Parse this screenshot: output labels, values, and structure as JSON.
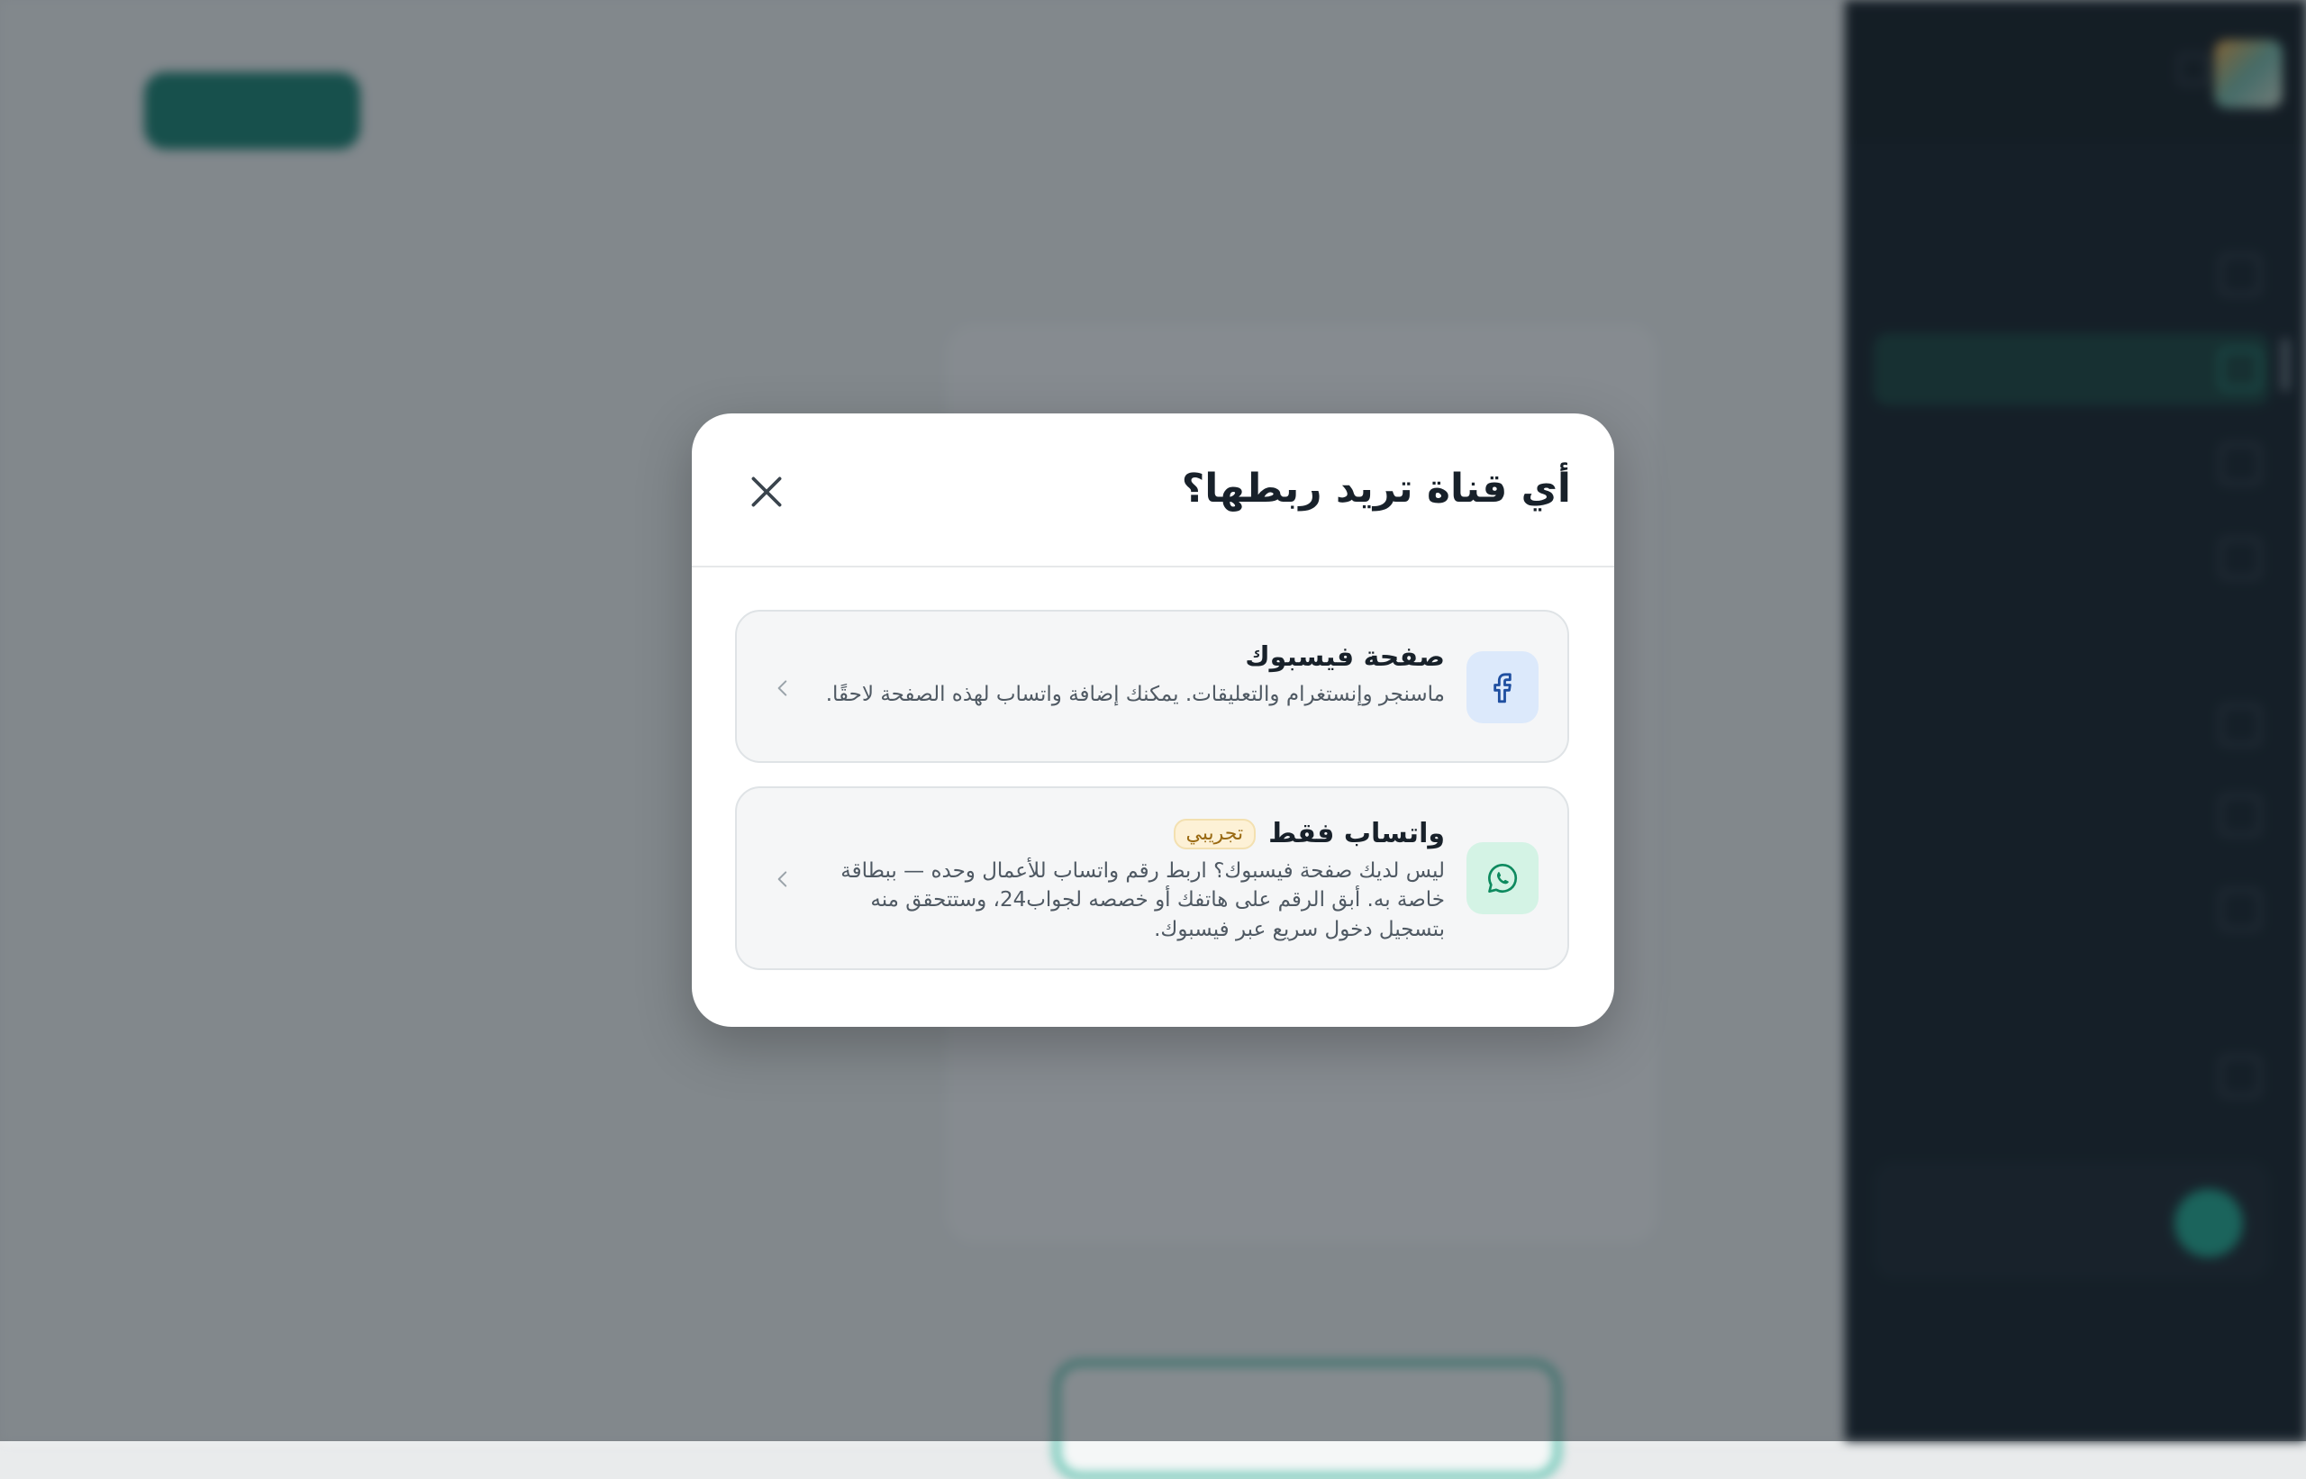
{
  "modal": {
    "title": "أي قناة تريد ربطها؟",
    "close_icon": "close-icon",
    "options": [
      {
        "id": "facebook",
        "title": "صفحة فيسبوك",
        "description": "ماسنجر وإنستغرام والتعليقات. يمكنك إضافة واتساب لهذه الصفحة لاحقًا.",
        "icon": "facebook-icon",
        "icon_color": "#1f4fa0",
        "icon_bg": "#dce9fb"
      },
      {
        "id": "whatsapp",
        "title": "واتساب فقط",
        "badge": "تجريبي",
        "description": "ليس لديك صفحة فيسبوك؟ اربط رقم واتساب للأعمال وحده — ببطاقة خاصة به. أبق الرقم على هاتفك أو خصصه لجواب24، وستتحقق منه بتسجيل دخول سريع عبر فيسبوك.",
        "icon": "whatsapp-icon",
        "icon_color": "#0e8a5f",
        "icon_bg": "#d4f3e5"
      }
    ]
  },
  "colors": {
    "accent": "#0f7b6b",
    "overlay": "rgba(30,40,48,0.52)",
    "sidebar_bg": "#0b1620"
  }
}
